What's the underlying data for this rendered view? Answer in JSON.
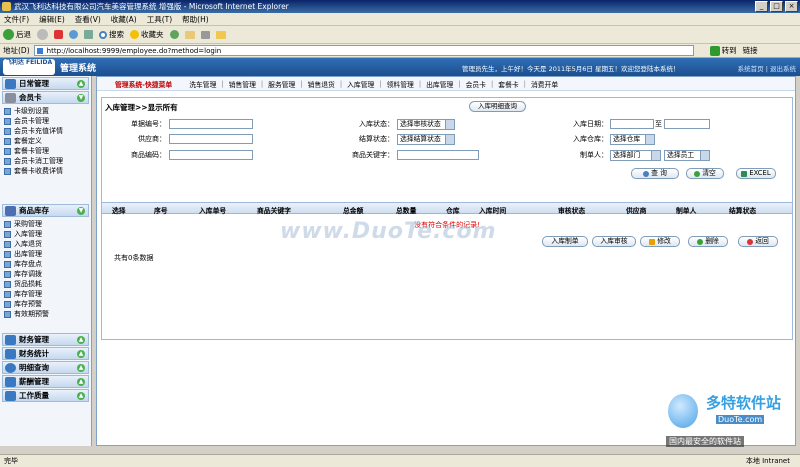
{
  "window": {
    "title": "武汉飞利达科技有限公司汽车美容管理系统 增强版 - Microsoft Internet Explorer",
    "min": "_",
    "max": "□",
    "close": "×"
  },
  "menubar": [
    "文件(F)",
    "编辑(E)",
    "查看(V)",
    "收藏(A)",
    "工具(T)",
    "帮助(H)"
  ],
  "toolbar": {
    "back": "后退",
    "search": "搜索",
    "favorites": "收藏夹"
  },
  "address": {
    "label": "地址(D)",
    "url": "http://localhost:9999/employee.do?method=login",
    "go": "转到",
    "links": "链接"
  },
  "header": {
    "logo_text": "飞利达 FEILIDA",
    "app_name": "管理系统",
    "greeting": "管理员先生，上午好！今天是 2011年5月6日 星期五！欢迎您登陆本系统！",
    "links": "系统首页 | 退出系统"
  },
  "sidebar": {
    "groups": [
      {
        "title": "日常管理",
        "items": []
      },
      {
        "title": "会员卡",
        "items": [
          "卡级别设置",
          "会员卡管理",
          "会员卡充值详情",
          "套餐定义",
          "套餐卡管理",
          "会员卡消工管理",
          "套餐卡收费详情"
        ]
      },
      {
        "title": "商品库存",
        "items": [
          "采购管理",
          "入库管理",
          "入库退货",
          "出库管理",
          "库存盘点",
          "库存调拨",
          "货品损耗",
          "库存管理",
          "库存预警",
          "有效期预警"
        ]
      },
      {
        "title": "财务管理",
        "items": []
      },
      {
        "title": "财务统计",
        "items": []
      },
      {
        "title": "明细查询",
        "items": []
      },
      {
        "title": "薪酬管理",
        "items": []
      },
      {
        "title": "工作质量",
        "items": []
      }
    ]
  },
  "quicknav": {
    "title": "管理系统-快捷菜单",
    "links": [
      "洗车管理",
      "销售管理",
      "服务管理",
      "销售退货",
      "入库管理",
      "领料管理",
      "出库管理",
      "会员卡",
      "套餐卡",
      "消费开单"
    ]
  },
  "panel": {
    "title": "入库管理>>显示所有",
    "detail_button": "入库明细查询",
    "fields": {
      "order_no": "单据编号：",
      "status": "入库状态：",
      "status_value": "选择审核状态",
      "date": "入库日期：",
      "date_to": "至",
      "supplier": "供应商：",
      "settle": "结算状态：",
      "settle_value": "选择结算状态",
      "warehouse": "入库仓库：",
      "warehouse_value": "选择仓库",
      "goods_code": "商品编码：",
      "goods_keyword": "商品关键字：",
      "maker": "制单人：",
      "dept_value": "选择部门",
      "emp_value": "选择员工"
    },
    "buttons": {
      "query": "查 询",
      "clear": "清空",
      "excel": "EXCEL"
    },
    "columns": [
      "选择",
      "序号",
      "入库单号",
      "商品关键字",
      "总金额",
      "总数量",
      "仓库",
      "入库时间",
      "审核状态",
      "供应商",
      "制单人",
      "结算状态"
    ],
    "no_records": "没有符合条件的记录!",
    "actions": {
      "create": "入库制单",
      "audit": "入库审核",
      "edit": "修改",
      "delete": "删除",
      "back": "返回"
    },
    "total": "共有0条数据"
  },
  "watermark": {
    "main": "www.DuoTe.com",
    "brand": "多特软件站",
    "domain": "DuoTe.com",
    "slogan": "国内最安全的软件站"
  },
  "status": {
    "left": "完毕",
    "zone": "本地 Intranet"
  }
}
